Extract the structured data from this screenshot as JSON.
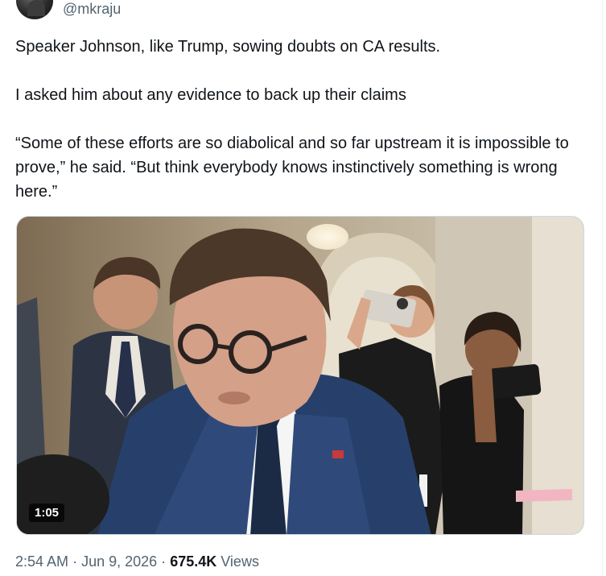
{
  "tweet": {
    "handle": "@mkraju",
    "text_lines": [
      "Speaker Johnson, like Trump, sowing doubts on CA results.",
      "I asked him about any evidence to back up their claims",
      "“Some of these efforts are so diabolical and so far upstream it is impossible to prove,” he said. “But think everybody knows instinctively something is wrong here.”"
    ]
  },
  "video": {
    "duration": "1:05"
  },
  "meta": {
    "time": "2:54 AM",
    "separator": "·",
    "date": "Jun 9, 2026",
    "views_count": "675.4K",
    "views_label": "Views"
  }
}
